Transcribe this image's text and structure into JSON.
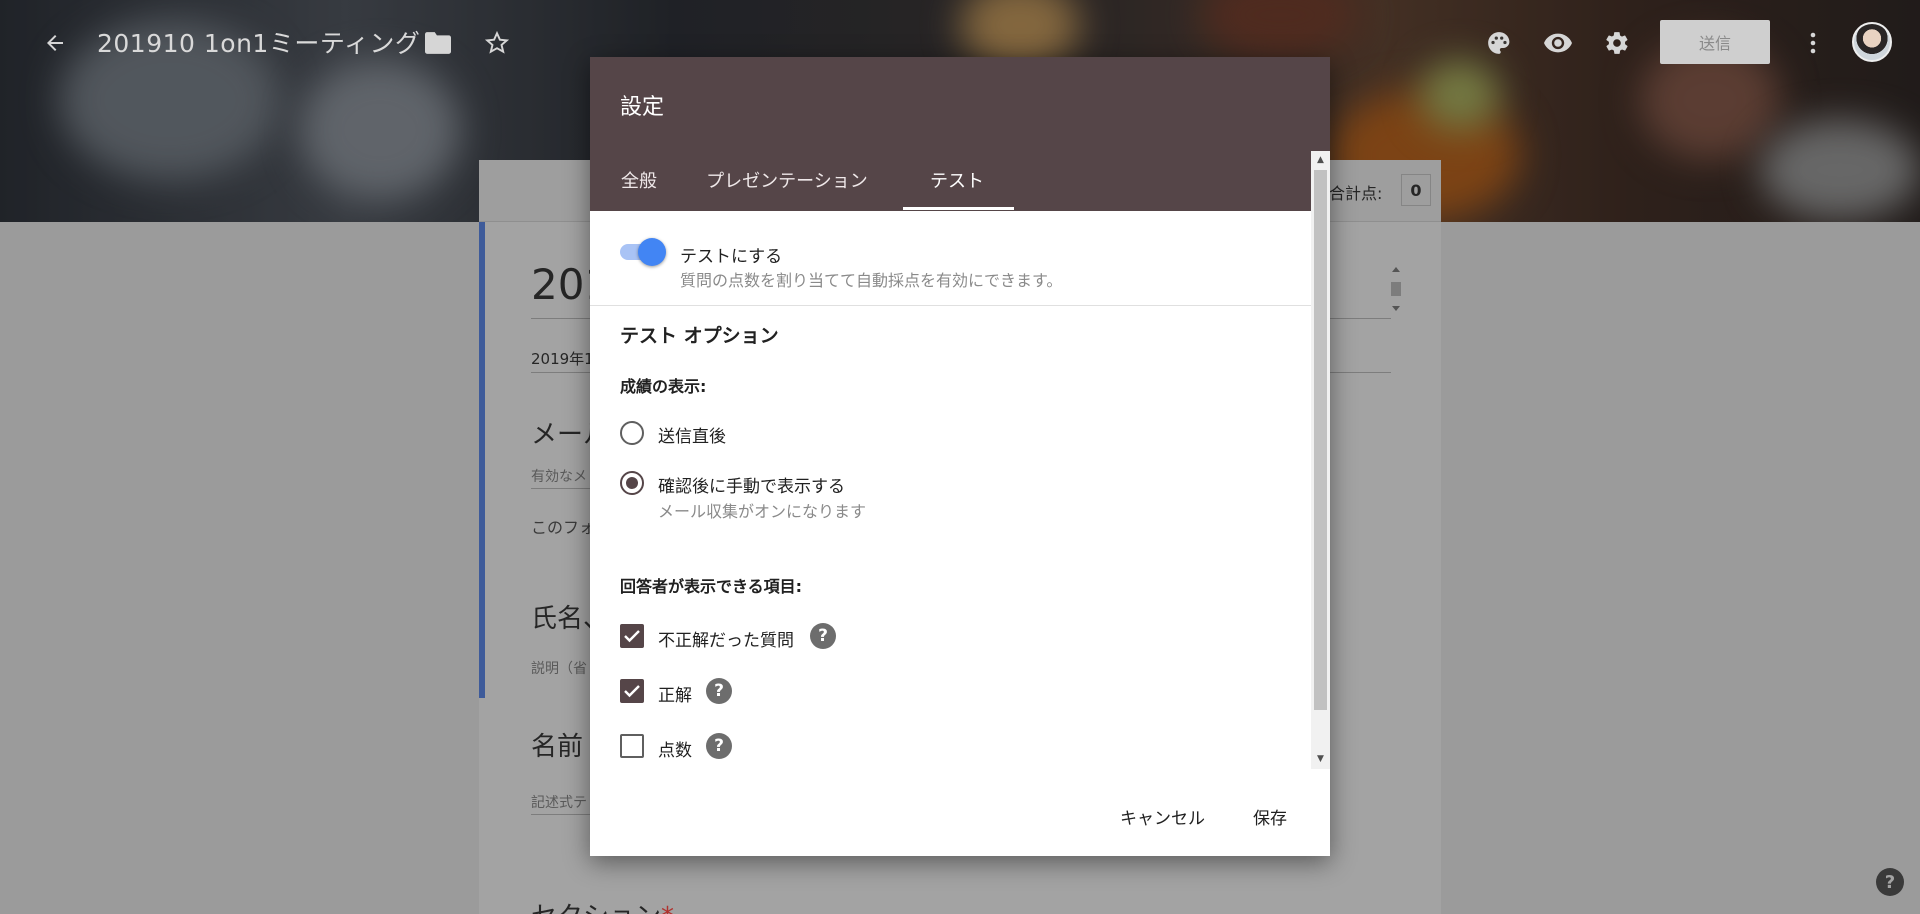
{
  "header": {
    "doc_title": "201910 1on1ミーティング",
    "send_label": "送信"
  },
  "form": {
    "total_label": "合計点:",
    "total_value": "0",
    "title_partial": "201",
    "date_partial": "2019年1",
    "email_q_partial": "メール",
    "email_hint_partial": "有効なメ",
    "email_note_partial": "このフォ",
    "name_q_partial": "氏名、",
    "desc_partial": "説明（省",
    "name2_q_partial": "名前",
    "text_hint_partial": "記述式テ",
    "section_partial": "セクション",
    "required_mark": "*"
  },
  "dialog": {
    "title": "設定",
    "tabs": [
      {
        "label": "全般",
        "active": false
      },
      {
        "label": "プレゼンテーション",
        "active": false
      },
      {
        "label": "テスト",
        "active": true
      }
    ],
    "make_quiz": {
      "label": "テストにする",
      "description": "質問の点数を割り当てて自動採点を有効にできます。",
      "enabled": true
    },
    "options_heading": "テスト オプション",
    "release_grade": {
      "label": "成績の表示:",
      "options": [
        {
          "label": "送信直後",
          "sub": "",
          "selected": false
        },
        {
          "label": "確認後に手動で表示する",
          "sub": "メール収集がオンになります",
          "selected": true
        }
      ]
    },
    "respondent_can_see": {
      "label": "回答者が表示できる項目:",
      "items": [
        {
          "label": "不正解だった質問",
          "checked": true
        },
        {
          "label": "正解",
          "checked": true
        },
        {
          "label": "点数",
          "checked": false
        }
      ]
    },
    "cancel_label": "キャンセル",
    "save_label": "保存"
  },
  "colors": {
    "dialog_header": "#554548",
    "toggle_on": "#4285f4",
    "checkbox_on": "#554548"
  },
  "icons": [
    "back-arrow-icon",
    "folder-icon",
    "star-icon",
    "palette-icon",
    "eye-icon",
    "gear-icon",
    "more-vert-icon",
    "help-icon"
  ]
}
